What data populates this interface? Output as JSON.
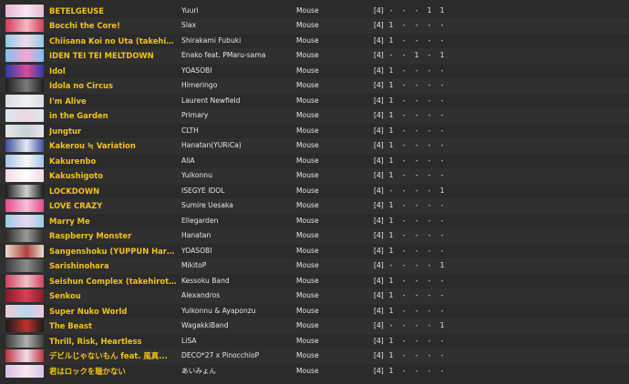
{
  "rows": [
    {
      "title": "BETELGEUSE",
      "artist": "Yuuri",
      "input": "Mouse",
      "level": "[4]",
      "counts": [
        "-",
        "-",
        "-",
        "1",
        "1"
      ],
      "thumb": [
        "#e9b7d0",
        "#f6e7f2"
      ]
    },
    {
      "title": "Bocchi the Core!",
      "artist": "Slax",
      "input": "Mouse",
      "level": "[4]",
      "counts": [
        "1",
        "-",
        "-",
        "-",
        "-"
      ],
      "thumb": [
        "#d83b55",
        "#f7b6c7"
      ]
    },
    {
      "title": "Chiisana Koi no Uta (takehirotei ...",
      "artist": "Shirakami Fubuki",
      "input": "Mouse",
      "level": "[4]",
      "counts": [
        "1",
        "-",
        "-",
        "-",
        "-"
      ],
      "thumb": [
        "#8ecbe8",
        "#f6d8e8"
      ]
    },
    {
      "title": "IDEN TEI TEI MELTDOWN",
      "artist": "Enako feat. PMaru-sama",
      "input": "Mouse",
      "level": "[4]",
      "counts": [
        "-",
        "-",
        "1",
        "-",
        "1"
      ],
      "thumb": [
        "#7ec0f0",
        "#f4a7d0"
      ]
    },
    {
      "title": "Idol",
      "artist": "YOASOBI",
      "input": "Mouse",
      "level": "[4]",
      "counts": [
        "1",
        "-",
        "-",
        "-",
        "-"
      ],
      "thumb": [
        "#2e3aa8",
        "#d64c9a"
      ]
    },
    {
      "title": "Idola no Circus",
      "artist": "Himeringo",
      "input": "Mouse",
      "level": "[4]",
      "counts": [
        "1",
        "-",
        "-",
        "-",
        "-"
      ],
      "thumb": [
        "#1e1e1e",
        "#7a7a7a"
      ]
    },
    {
      "title": "I'm Alive",
      "artist": "Laurent Newfield",
      "input": "Mouse",
      "level": "[4]",
      "counts": [
        "1",
        "-",
        "-",
        "-",
        "-"
      ],
      "thumb": [
        "#d9dde6",
        "#f1f1f1"
      ]
    },
    {
      "title": "in the Garden",
      "artist": "Primary",
      "input": "Mouse",
      "level": "[4]",
      "counts": [
        "1",
        "-",
        "-",
        "-",
        "-"
      ],
      "thumb": [
        "#d8e8f0",
        "#f0d6e0"
      ]
    },
    {
      "title": "Jungtur",
      "artist": "CLTH",
      "input": "Mouse",
      "level": "[4]",
      "counts": [
        "1",
        "-",
        "-",
        "-",
        "-"
      ],
      "thumb": [
        "#e6e6e6",
        "#c9cfd8"
      ]
    },
    {
      "title": "Kakerou ≒ Variation",
      "artist": "Hanatan(YURiCa)",
      "input": "Mouse",
      "level": "[4]",
      "counts": [
        "1",
        "-",
        "-",
        "-",
        "-"
      ],
      "thumb": [
        "#3b4f9e",
        "#e6eaf7"
      ]
    },
    {
      "title": "Kakurenbo",
      "artist": "AliA",
      "input": "Mouse",
      "level": "[4]",
      "counts": [
        "1",
        "-",
        "-",
        "-",
        "-"
      ],
      "thumb": [
        "#a3c6e8",
        "#f7f7f7"
      ]
    },
    {
      "title": "Kakushigoto",
      "artist": "Yuikonnu",
      "input": "Mouse",
      "level": "[4]",
      "counts": [
        "1",
        "-",
        "-",
        "-",
        "-"
      ],
      "thumb": [
        "#f1d9e4",
        "#ffffff"
      ]
    },
    {
      "title": "LOCKDOWN",
      "artist": "ISEGYE IDOL",
      "input": "Mouse",
      "level": "[4]",
      "counts": [
        "-",
        "-",
        "-",
        "-",
        "1"
      ],
      "thumb": [
        "#1a1a1a",
        "#d0d0d0"
      ]
    },
    {
      "title": "LOVE CRAZY",
      "artist": "Sumire Uesaka",
      "input": "Mouse",
      "level": "[4]",
      "counts": [
        "1",
        "-",
        "-",
        "-",
        "-"
      ],
      "thumb": [
        "#e84a8a",
        "#f6c0d8"
      ]
    },
    {
      "title": "Marry Me",
      "artist": "Ellegarden",
      "input": "Mouse",
      "level": "[4]",
      "counts": [
        "1",
        "-",
        "-",
        "-",
        "-"
      ],
      "thumb": [
        "#9ccbe6",
        "#e8d8f0"
      ]
    },
    {
      "title": "Raspberry Monster",
      "artist": "Hanatan",
      "input": "Mouse",
      "level": "[4]",
      "counts": [
        "1",
        "-",
        "-",
        "-",
        "-"
      ],
      "thumb": [
        "#2a2a2a",
        "#9a9a9a"
      ]
    },
    {
      "title": "Sangenshoku (YUPPUN Hardc...",
      "artist": "YOASOBI",
      "input": "Mouse",
      "level": "[4]",
      "counts": [
        "1",
        "-",
        "-",
        "-",
        "-"
      ],
      "thumb": [
        "#e8e0d0",
        "#b04040"
      ]
    },
    {
      "title": "Sarishinohara",
      "artist": "MikitoP",
      "input": "Mouse",
      "level": "[4]",
      "counts": [
        "-",
        "-",
        "-",
        "-",
        "1"
      ],
      "thumb": [
        "#3c3c3c",
        "#8a8a8a"
      ]
    },
    {
      "title": "Seishun Complex (takehirotei h...",
      "artist": "Kessoku Band",
      "input": "Mouse",
      "level": "[4]",
      "counts": [
        "1",
        "-",
        "-",
        "-",
        "-"
      ],
      "thumb": [
        "#d04060",
        "#f0c0c8"
      ]
    },
    {
      "title": "Senkou",
      "artist": "Alexandros",
      "input": "Mouse",
      "level": "[4]",
      "counts": [
        "1",
        "-",
        "-",
        "-",
        "-"
      ],
      "thumb": [
        "#8a1a2a",
        "#d84050"
      ]
    },
    {
      "title": "Super Nuko World",
      "artist": "Yuikonnu & Ayaponzu",
      "input": "Mouse",
      "level": "[4]",
      "counts": [
        "1",
        "-",
        "-",
        "-",
        "-"
      ],
      "thumb": [
        "#f0c8d8",
        "#b8d8f0"
      ]
    },
    {
      "title": "The Beast",
      "artist": "WagakkiBand",
      "input": "Mouse",
      "level": "[4]",
      "counts": [
        "-",
        "-",
        "-",
        "-",
        "1"
      ],
      "thumb": [
        "#1a1a1a",
        "#c03030"
      ]
    },
    {
      "title": "Thrill, Risk, Heartless",
      "artist": "LiSA",
      "input": "Mouse",
      "level": "[4]",
      "counts": [
        "1",
        "-",
        "-",
        "-",
        "-"
      ],
      "thumb": [
        "#3a3a3a",
        "#b0b0b0"
      ]
    },
    {
      "title": "デビルじゃないもん feat. 風真...",
      "artist": "DECO*27 x PinocchioP",
      "input": "Mouse",
      "level": "[4]",
      "counts": [
        "1",
        "-",
        "-",
        "-",
        "-"
      ],
      "thumb": [
        "#c03040",
        "#f0e0e8"
      ]
    },
    {
      "title": "君はロックを聴かない",
      "artist": "あいみょん",
      "input": "Mouse",
      "level": "[4]",
      "counts": [
        "1",
        "-",
        "-",
        "-",
        "-"
      ],
      "thumb": [
        "#d8c0e8",
        "#f8e8f0"
      ]
    }
  ]
}
